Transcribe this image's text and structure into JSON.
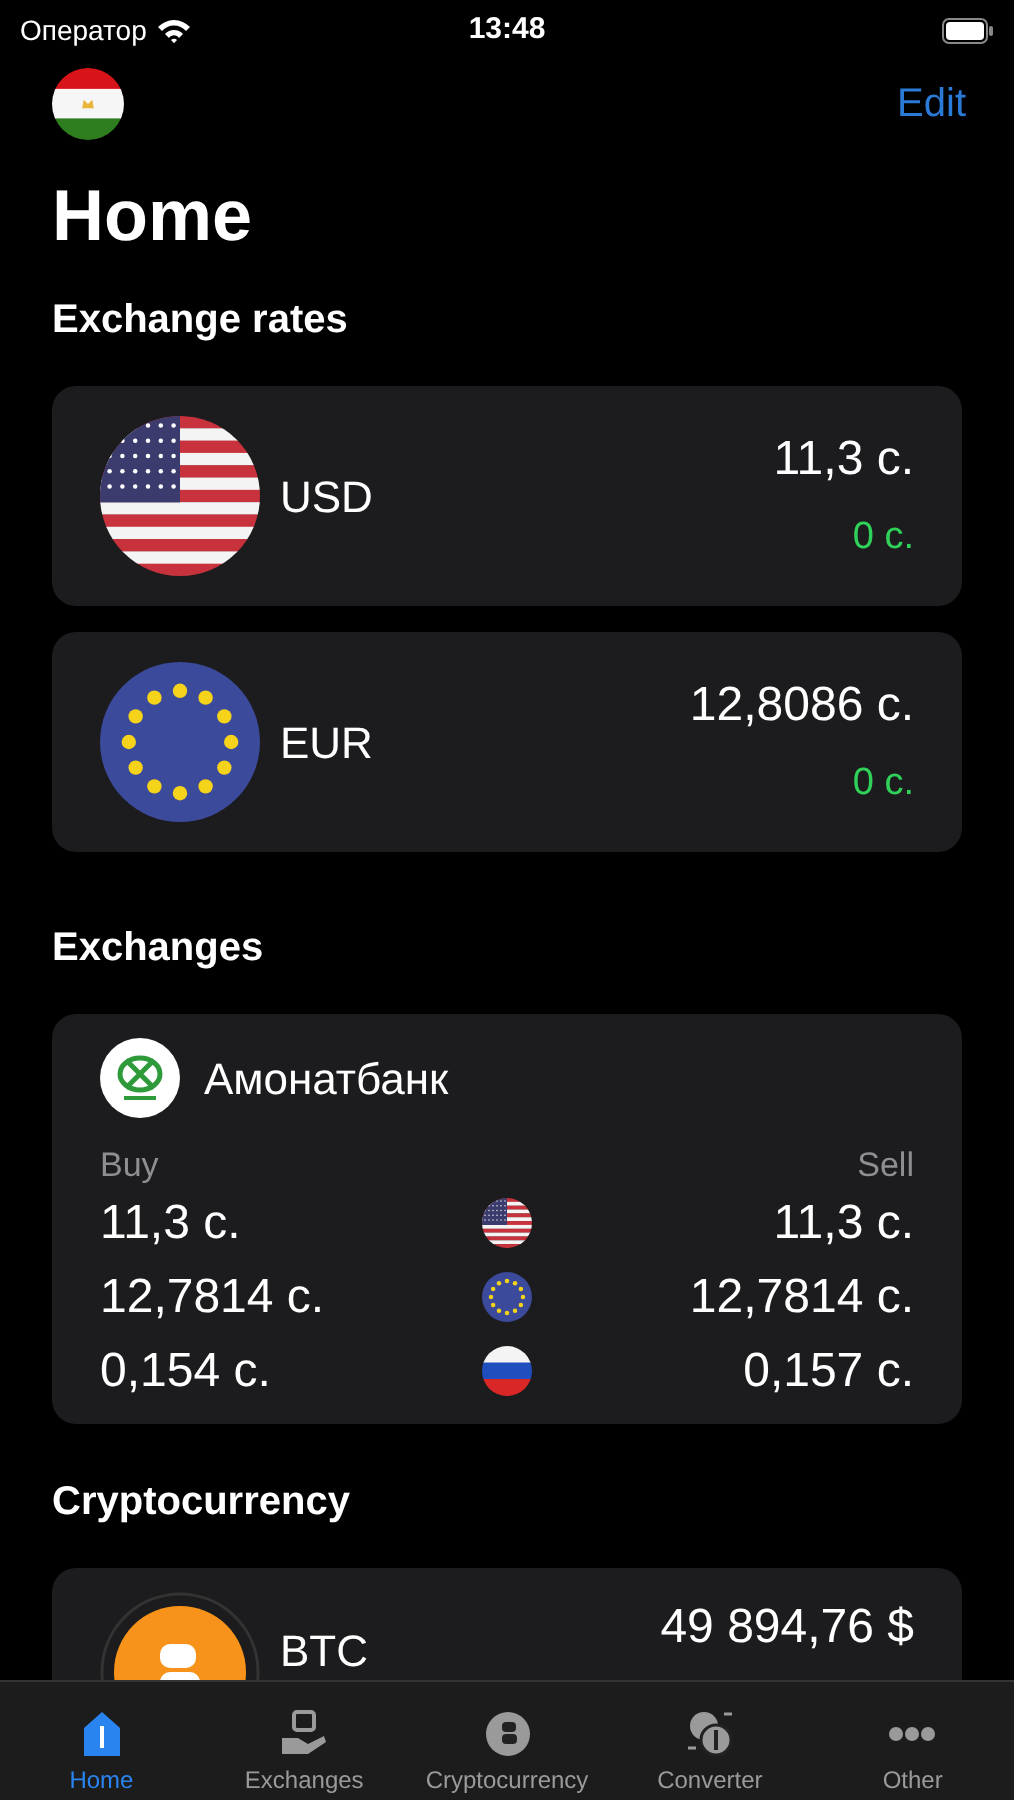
{
  "status_bar": {
    "carrier": "Оператор",
    "time": "13:48"
  },
  "nav": {
    "flag": {
      "kind": "tj"
    },
    "edit": "Edit"
  },
  "title": "Home",
  "exchange_rates": {
    "heading": "Exchange rates",
    "items": [
      {
        "kind": "us",
        "code": "USD",
        "rate": "11,3 с.",
        "change": "0 с."
      },
      {
        "kind": "eu",
        "code": "EUR",
        "rate": "12,8086 с.",
        "change": "0 с."
      }
    ]
  },
  "exchanges": {
    "heading": "Exchanges",
    "banks": [
      {
        "name": "Амонатбанк",
        "buy_label": "Buy",
        "sell_label": "Sell",
        "rows": [
          {
            "kind": "us",
            "buy": "11,3 с.",
            "sell": "11,3 с."
          },
          {
            "kind": "eu",
            "buy": "12,7814 с.",
            "sell": "12,7814 с."
          },
          {
            "kind": "ru",
            "buy": "0,154 с.",
            "sell": "0,157 с."
          }
        ]
      }
    ]
  },
  "cryptocurrency": {
    "heading": "Cryptocurrency",
    "items": [
      {
        "code": "BTC",
        "price": "49 894,76 $"
      }
    ]
  },
  "tab_bar": [
    {
      "kind": "home",
      "label": "Home",
      "selected": true
    },
    {
      "kind": "exchanges",
      "label": "Exchanges",
      "selected": false
    },
    {
      "kind": "crypto",
      "label": "Cryptocurrency",
      "selected": false
    },
    {
      "kind": "converter",
      "label": "Converter",
      "selected": false
    },
    {
      "kind": "other",
      "label": "Other",
      "selected": false
    }
  ]
}
